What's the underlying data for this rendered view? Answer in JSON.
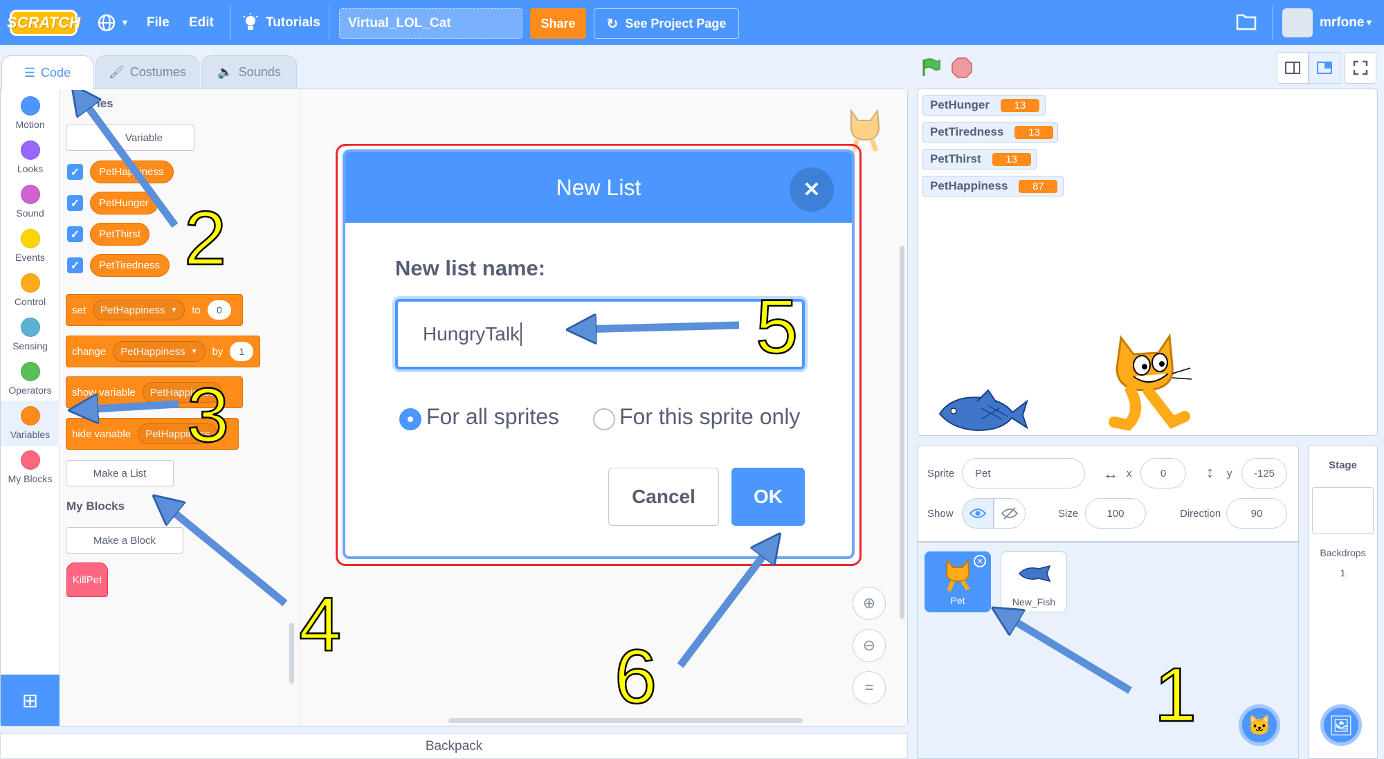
{
  "menubar": {
    "logo": "SCRATCH",
    "file": "File",
    "edit": "Edit",
    "tutorials": "Tutorials",
    "project_title": "Virtual_LOL_Cat",
    "share": "Share",
    "see_project_page": "See Project Page",
    "username": "mrfone"
  },
  "tabs": [
    {
      "label": "Code"
    },
    {
      "label": "Costumes"
    },
    {
      "label": "Sounds"
    }
  ],
  "categories": [
    {
      "label": "Motion",
      "color": "#4c97ff"
    },
    {
      "label": "Looks",
      "color": "#9966ff"
    },
    {
      "label": "Sound",
      "color": "#cf63cf"
    },
    {
      "label": "Events",
      "color": "#ffd500"
    },
    {
      "label": "Control",
      "color": "#ffab19"
    },
    {
      "label": "Sensing",
      "color": "#5cb1d6"
    },
    {
      "label": "Operators",
      "color": "#59c059"
    },
    {
      "label": "Variables",
      "color": "#ff8c1a"
    },
    {
      "label": "My Blocks",
      "color": "#ff6680"
    }
  ],
  "palette": {
    "variables_heading": "les",
    "make_variable_btn": "Variable",
    "variables": [
      "PetHappiness",
      "PetHunger",
      "PetThirst",
      "PetTiredness"
    ],
    "set_block": {
      "kw": "set",
      "var": "PetHappiness",
      "to": "to",
      "value": "0"
    },
    "change_block": {
      "kw": "change",
      "var": "PetHappiness",
      "by": "by",
      "value": "1"
    },
    "show_block": {
      "kw": "show variable",
      "var": "PetHappiness"
    },
    "hide_block": {
      "kw": "hide variable",
      "var": "PetHappiness"
    },
    "make_list_btn": "Make a List",
    "my_blocks_heading": "My Blocks",
    "make_block_btn": "Make a Block",
    "custom_block": "KillPet"
  },
  "backpack": "Backpack",
  "stage_monitors": [
    {
      "name": "PetHunger",
      "value": "13"
    },
    {
      "name": "PetTiredness",
      "value": "13"
    },
    {
      "name": "PetThirst",
      "value": "13"
    },
    {
      "name": "PetHappiness",
      "value": "87"
    }
  ],
  "sprite_info": {
    "sprite_label": "Sprite",
    "sprite_name": "Pet",
    "x_label": "x",
    "x_value": "0",
    "y_label": "y",
    "y_value": "-125",
    "show_label": "Show",
    "size_label": "Size",
    "size_value": "100",
    "direction_label": "Direction",
    "direction_value": "90"
  },
  "sprites": [
    {
      "name": "Pet"
    },
    {
      "name": "New_Fish"
    }
  ],
  "stage_panel": {
    "title": "Stage",
    "backdrops_label": "Backdrops",
    "backdrops_count": "1"
  },
  "modal": {
    "title": "New List",
    "label": "New list name:",
    "input_value": "HungryTalk",
    "radio_all": "For all sprites",
    "radio_this": "For this sprite only",
    "cancel": "Cancel",
    "ok": "OK"
  },
  "annotations": [
    "1",
    "2",
    "3",
    "4",
    "5",
    "6"
  ]
}
